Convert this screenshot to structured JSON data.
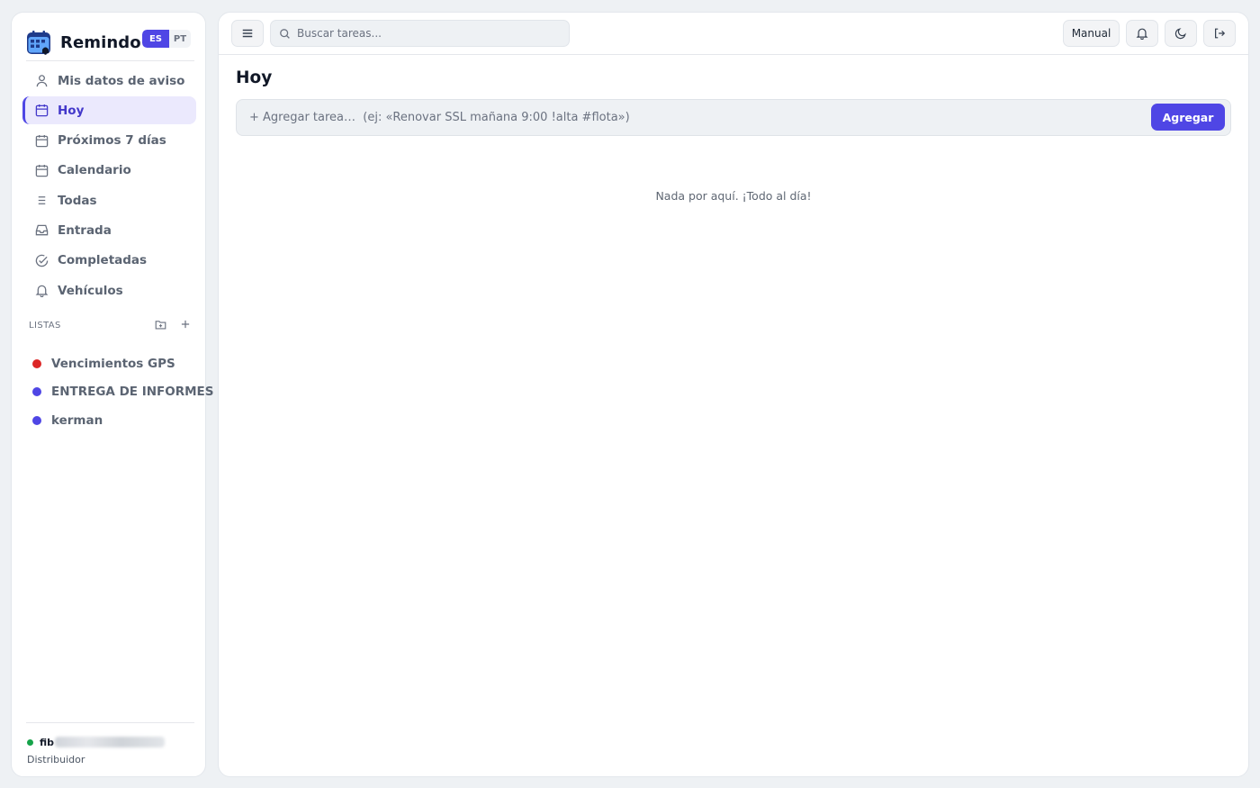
{
  "brand": {
    "name": "Remindo",
    "logo_icon": "calendar-bell-icon"
  },
  "languages": [
    {
      "code": "ES",
      "active": true
    },
    {
      "code": "PT",
      "active": false
    }
  ],
  "nav": {
    "items": [
      {
        "label": "Mis datos de aviso",
        "icon": "user-icon",
        "active": false
      },
      {
        "label": "Hoy",
        "icon": "calendar-icon",
        "active": true
      },
      {
        "label": "Próximos 7 días",
        "icon": "calendar-icon",
        "active": false
      },
      {
        "label": "Calendario",
        "icon": "calendar-icon",
        "active": false
      },
      {
        "label": "Todas",
        "icon": "list-icon",
        "active": false
      },
      {
        "label": "Entrada",
        "icon": "inbox-icon",
        "active": false
      },
      {
        "label": "Completadas",
        "icon": "check-circle-icon",
        "active": false
      },
      {
        "label": "Vehículos",
        "icon": "bell-icon",
        "active": false
      }
    ]
  },
  "lists_section": {
    "title": "LISTAS",
    "items": [
      {
        "label": "Vencimientos GPS",
        "color": "#dc2626"
      },
      {
        "label": "ENTREGA DE INFORMES",
        "color": "#4f46e5"
      },
      {
        "label": "kerman",
        "color": "#4f46e5"
      }
    ]
  },
  "user": {
    "name": "fib",
    "role": "Distribuidor",
    "status_color": "#16a34a"
  },
  "topbar": {
    "search_placeholder": "Buscar tareas...",
    "manual_label": "Manual"
  },
  "main": {
    "title": "Hoy",
    "add_placeholder": "+ Agregar tarea…  (ej: «Renovar SSL mañana 9:00 !alta #flota»)",
    "add_button": "Agregar",
    "empty_message": "Nada por aquí. ¡Todo al día!"
  },
  "colors": {
    "accent": "#4f46e5",
    "active_bg": "#ebe9fd"
  }
}
